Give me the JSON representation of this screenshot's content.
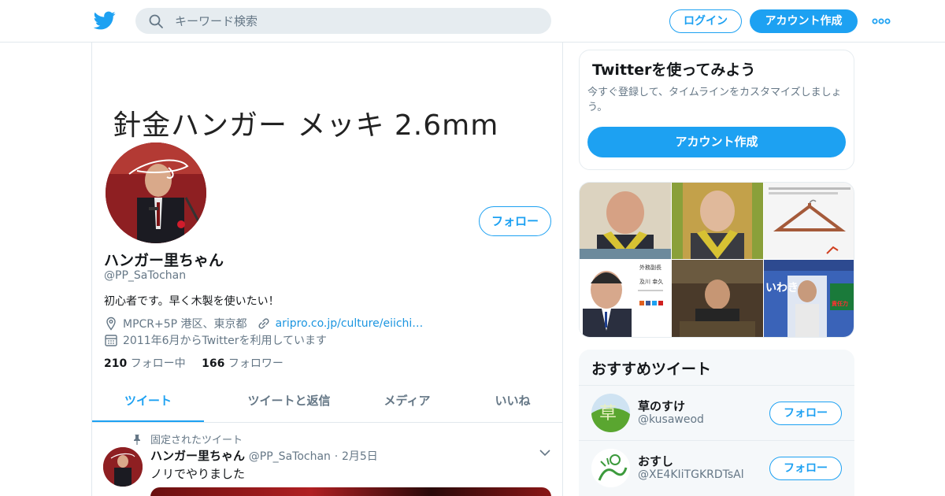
{
  "header": {
    "logo_icon": "twitter-bird-icon",
    "search_placeholder": "キーワード検索",
    "login_label": "ログイン",
    "signup_label": "アカウント作成",
    "more_icon": "more-dots-icon",
    "brand_color": "#1da1f2"
  },
  "profile": {
    "banner_text": "針金ハンガー メッキ 2.6mm",
    "follow_label": "フォロー",
    "name": "ハンガー里ちゃん",
    "handle": "@PP_SaTochan",
    "bio": "初心者です。早く木製を使いたい！",
    "location": "MPCR+5P 港区、東京都",
    "url": "aripro.co.jp/culture/eiichi…",
    "joined": "2011年6月からTwitterを利用しています",
    "following_count": "210",
    "following_label": "フォロー中",
    "followers_count": "166",
    "followers_label": "フォロワー"
  },
  "tabs": [
    {
      "label": "ツイート",
      "active": true
    },
    {
      "label": "ツイートと返信",
      "active": false
    },
    {
      "label": "メディア",
      "active": false
    },
    {
      "label": "いいね",
      "active": false
    }
  ],
  "pinned_tweet": {
    "pinned_label": "固定されたツイート",
    "name": "ハンガー里ちゃん",
    "handle": "@PP_SaTochan",
    "separator": "·",
    "date": "2月5日",
    "text": "ノリでやりました"
  },
  "signup_card": {
    "title": "Twitterを使ってみよう",
    "description": "今すぐ登録して、タイムラインをカスタマイズしましょう。",
    "button_label": "アカウント作成"
  },
  "media_grid": {
    "cell_4_title": "外務副長",
    "cell_4_subtitle": "及川 幸久",
    "cell_6_big_text": "いわき",
    "cell_6_side_text": "責任力"
  },
  "recommended": {
    "title": "おすすめツイート",
    "follow_label": "フォロー",
    "accounts": [
      {
        "name": "草のすけ",
        "handle": "@kusaweod",
        "avatar_glyph": "草"
      },
      {
        "name": "おすし",
        "handle": "@XE4KIiTGKRDTsAl"
      }
    ]
  }
}
